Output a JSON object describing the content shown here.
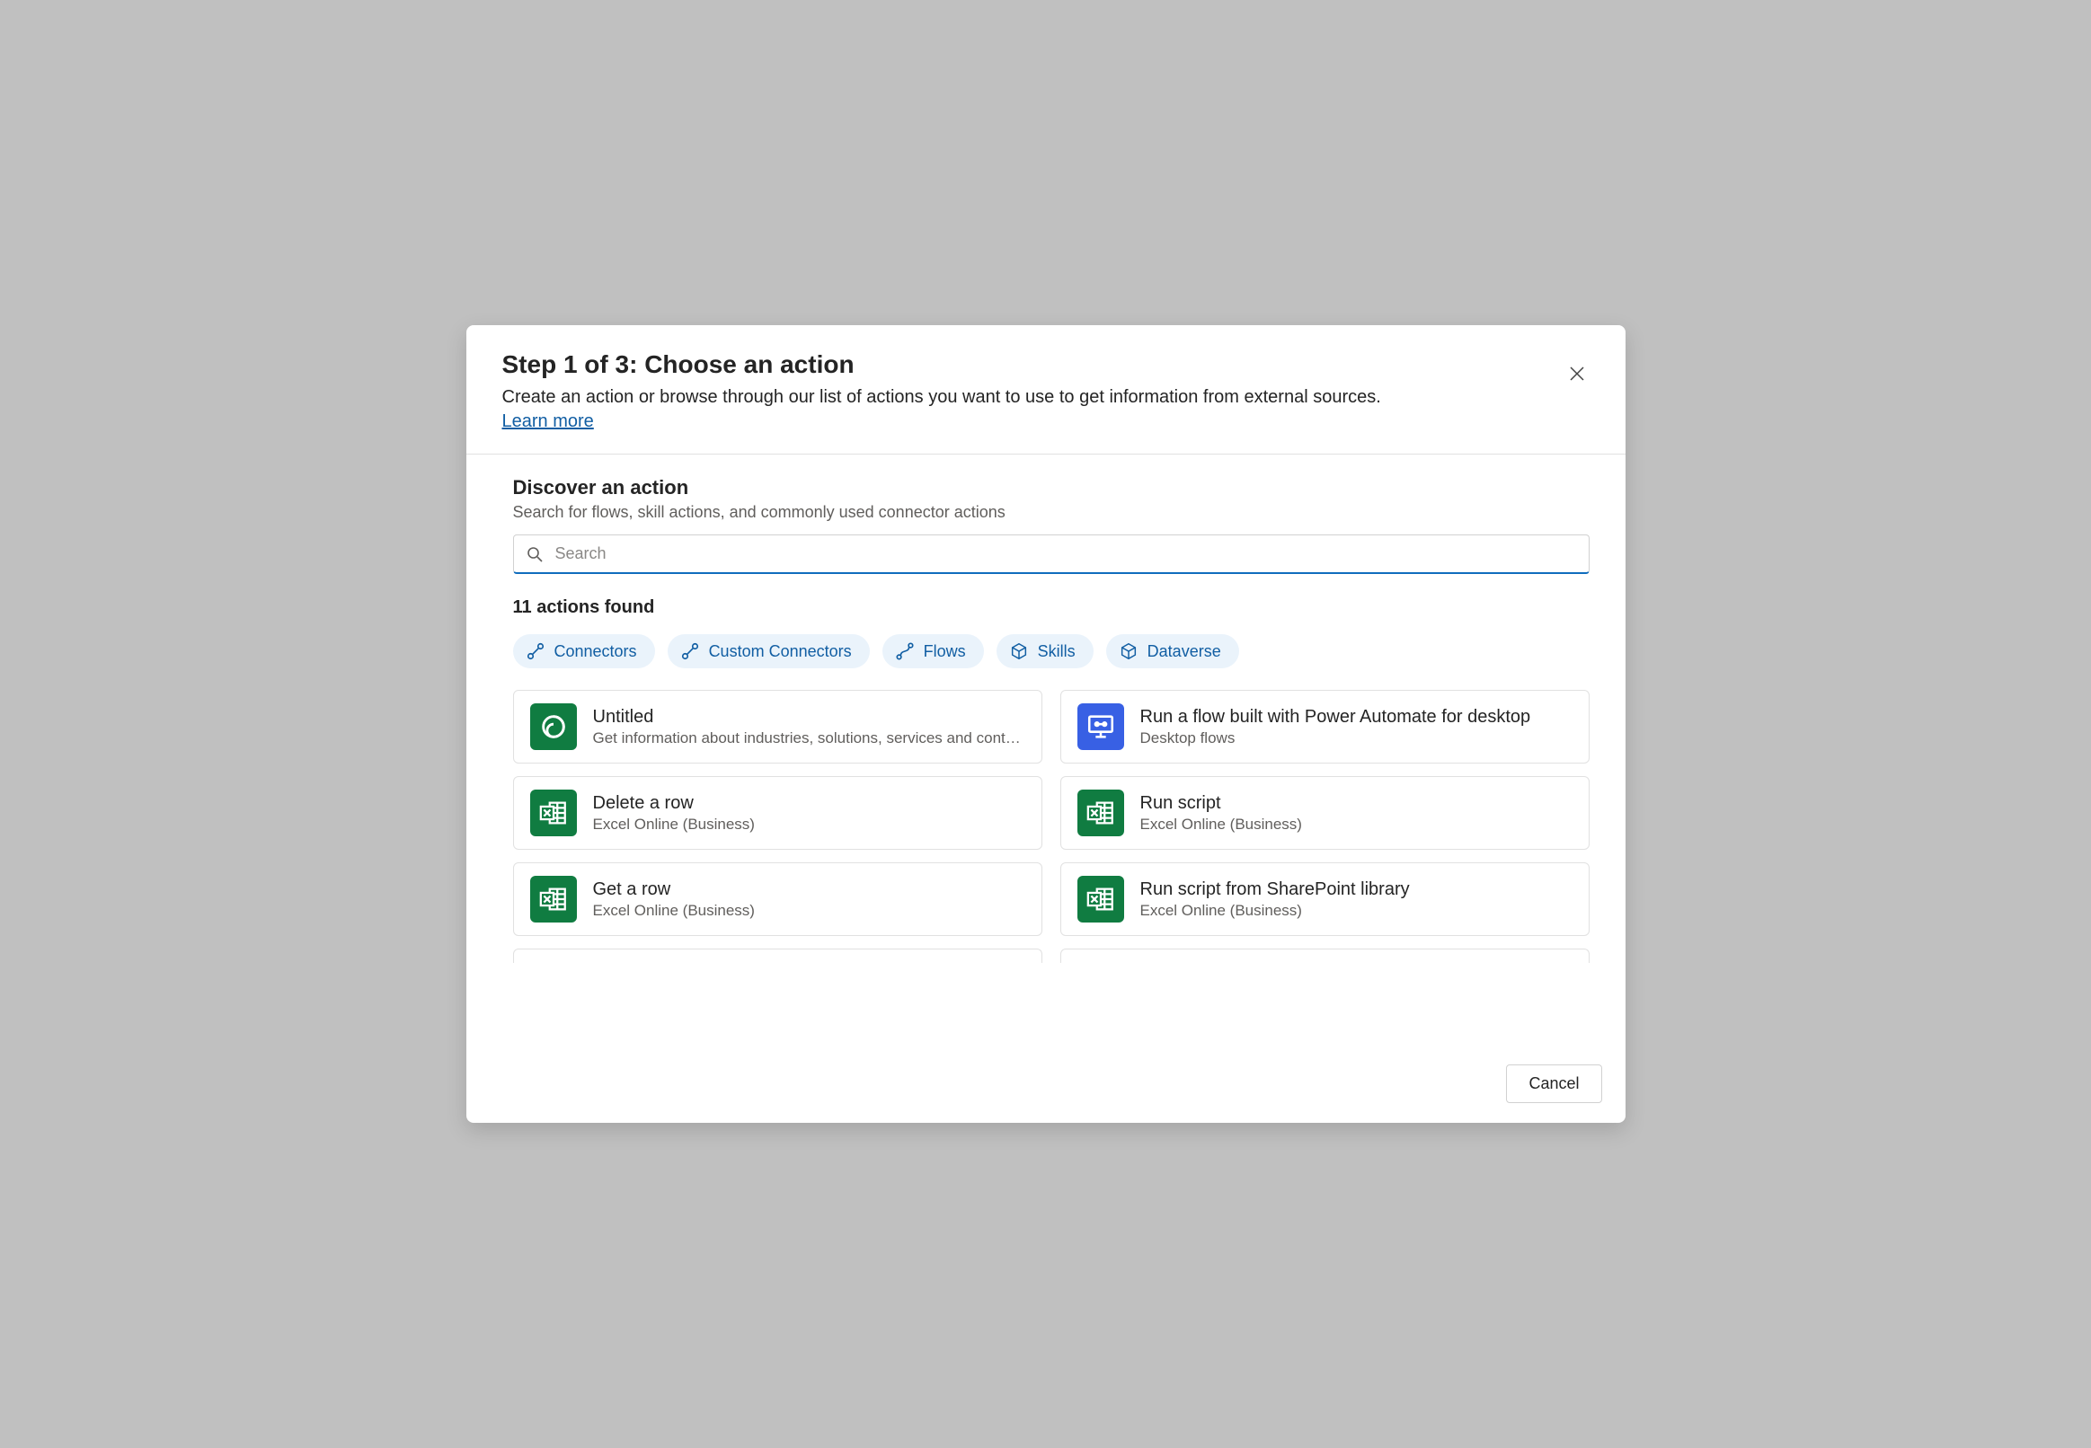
{
  "header": {
    "title": "Step 1 of 3: Choose an action",
    "subtitle": "Create an action or browse through our list of actions you want to use to get information from external sources.",
    "learn_more": "Learn more"
  },
  "discover": {
    "title": "Discover an action",
    "subtitle": "Search for flows, skill actions, and commonly used connector actions"
  },
  "search": {
    "placeholder": "Search",
    "value": ""
  },
  "results_label": "11 actions found",
  "chips": [
    {
      "label": "Connectors",
      "icon": "connector-icon"
    },
    {
      "label": "Custom Connectors",
      "icon": "connector-icon"
    },
    {
      "label": "Flows",
      "icon": "flow-icon"
    },
    {
      "label": "Skills",
      "icon": "cube-icon"
    },
    {
      "label": "Dataverse",
      "icon": "cube-icon"
    }
  ],
  "actions": [
    {
      "title": "Untitled",
      "subtitle": "Get information about industries, solutions, services and cont…",
      "icon": "swirl-icon",
      "icon_class": "icon-green"
    },
    {
      "title": "Run a flow built with Power Automate for desktop",
      "subtitle": "Desktop flows",
      "icon": "desktop-flow-icon",
      "icon_class": "icon-blue"
    },
    {
      "title": "Delete a row",
      "subtitle": "Excel Online (Business)",
      "icon": "excel-icon",
      "icon_class": "icon-green"
    },
    {
      "title": "Run script",
      "subtitle": "Excel Online (Business)",
      "icon": "excel-icon",
      "icon_class": "icon-green"
    },
    {
      "title": "Get a row",
      "subtitle": "Excel Online (Business)",
      "icon": "excel-icon",
      "icon_class": "icon-green"
    },
    {
      "title": "Run script from SharePoint library",
      "subtitle": "Excel Online (Business)",
      "icon": "excel-icon",
      "icon_class": "icon-green"
    }
  ],
  "footer": {
    "cancel": "Cancel"
  }
}
